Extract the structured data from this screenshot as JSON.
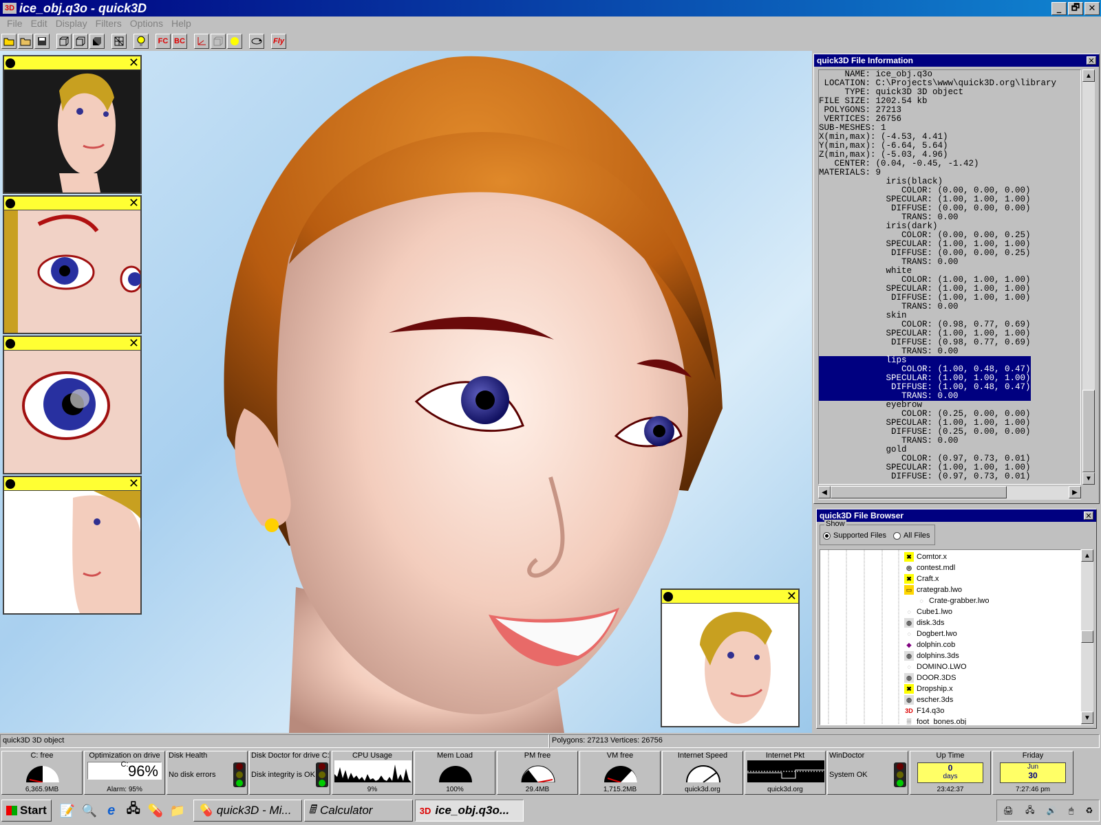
{
  "window": {
    "icon_label": "3D",
    "title": "ice_obj.q3o - quick3D",
    "buttons": [
      "_",
      "🗗",
      "✕"
    ]
  },
  "menu": [
    "File",
    "Edit",
    "Display",
    "Filters",
    "Options",
    "Help"
  ],
  "toolbar": {
    "fc_label": "FC",
    "bc_label": "BC",
    "fly_label": "Fly"
  },
  "thumbnails": {
    "close": "✕"
  },
  "info_panel": {
    "title": "quick3D File Information",
    "close": "✕",
    "lines_before": [
      "     NAME: ice_obj.q3o",
      " LOCATION: C:\\Projects\\www\\quick3D.org\\library",
      "     TYPE: quick3D 3D object",
      "FILE SIZE: 1202.54 kb",
      " POLYGONS: 27213",
      " VERTICES: 26756",
      "SUB-MESHES: 1",
      "X(min,max): (-4.53, 4.41)",
      "Y(min,max): (-6.64, 5.64)",
      "Z(min,max): (-5.03, 4.96)",
      "   CENTER: (0.04, -0.45, -1.42)",
      "MATERIALS: 9",
      "             iris(black)",
      "                COLOR: (0.00, 0.00, 0.00)",
      "             SPECULAR: (1.00, 1.00, 1.00)",
      "              DIFFUSE: (0.00, 0.00, 0.00)",
      "                TRANS: 0.00",
      "             iris(dark)",
      "                COLOR: (0.00, 0.00, 0.25)",
      "             SPECULAR: (1.00, 1.00, 1.00)",
      "              DIFFUSE: (0.00, 0.00, 0.25)",
      "                TRANS: 0.00",
      "             white",
      "                COLOR: (1.00, 1.00, 1.00)",
      "             SPECULAR: (1.00, 1.00, 1.00)",
      "              DIFFUSE: (1.00, 1.00, 1.00)",
      "                TRANS: 0.00",
      "             skin",
      "                COLOR: (0.98, 0.77, 0.69)",
      "             SPECULAR: (1.00, 1.00, 1.00)",
      "              DIFFUSE: (0.98, 0.77, 0.69)",
      "                TRANS: 0.00"
    ],
    "lines_selected": [
      "             lips",
      "                COLOR: (1.00, 0.48, 0.47)",
      "             SPECULAR: (1.00, 1.00, 1.00)",
      "              DIFFUSE: (1.00, 0.48, 0.47)",
      "                TRANS: 0.00"
    ],
    "lines_after": [
      "             eyebrow",
      "                COLOR: (0.25, 0.00, 0.00)",
      "             SPECULAR: (1.00, 1.00, 1.00)",
      "              DIFFUSE: (0.25, 0.00, 0.00)",
      "                TRANS: 0.00",
      "             gold",
      "                COLOR: (0.97, 0.73, 0.01)",
      "             SPECULAR: (1.00, 1.00, 1.00)",
      "              DIFFUSE: (0.97, 0.73, 0.01)"
    ]
  },
  "browser_panel": {
    "title": "quick3D File Browser",
    "close": "✕",
    "show_label": "Show",
    "radio_supported": "Supported Files",
    "radio_all": "All Files",
    "files": [
      {
        "name": "Comtor.x",
        "icon": "x-file-icon"
      },
      {
        "name": "contest.mdl",
        "icon": "mdl-file-icon"
      },
      {
        "name": "Craft.x",
        "icon": "x-file-icon"
      },
      {
        "name": "crategrab.lwo",
        "icon": "folder-icon"
      },
      {
        "name": "Crate-grabber.lwo",
        "icon": "lwo-file-icon"
      },
      {
        "name": "Cube1.lwo",
        "icon": "lwo-file-icon"
      },
      {
        "name": "disk.3ds",
        "icon": "3ds-file-icon"
      },
      {
        "name": "Dogbert.lwo",
        "icon": "lwo-file-icon"
      },
      {
        "name": "dolphin.cob",
        "icon": "cob-file-icon"
      },
      {
        "name": "dolphins.3ds",
        "icon": "3ds-file-icon"
      },
      {
        "name": "DOMINO.LWO",
        "icon": "lwo-file-icon"
      },
      {
        "name": "DOOR.3DS",
        "icon": "3ds-file-icon"
      },
      {
        "name": "Dropship.x",
        "icon": "x-file-icon"
      },
      {
        "name": "escher.3ds",
        "icon": "3ds-file-icon"
      },
      {
        "name": "F14.q3o",
        "icon": "q3o-file-icon"
      },
      {
        "name": "foot_bones.obj",
        "icon": "obj-file-icon"
      }
    ]
  },
  "status": {
    "left": "quick3D 3D object",
    "right": "Polygons: 27213  Vertices: 26756"
  },
  "gadgets": [
    {
      "label": "C: free",
      "value": "6,365.9MB"
    },
    {
      "label": "Optimization on drive C:",
      "big": "96%",
      "value": "Alarm: 95%"
    },
    {
      "label": "Disk Health",
      "text": "No disk errors"
    },
    {
      "label": "Disk Doctor for drive C:",
      "text": "Disk integrity is OK"
    },
    {
      "label": "CPU Usage",
      "value": "9%"
    },
    {
      "label": "Mem Load",
      "value": "100%"
    },
    {
      "label": "PM free",
      "value": "29.4MB"
    },
    {
      "label": "VM free",
      "value": "1,715.2MB"
    },
    {
      "label": "Internet Speed",
      "value": "quick3d.org"
    },
    {
      "label": "Internet Pkt",
      "value": "quick3d.org"
    },
    {
      "label": "WinDoctor",
      "text": "System OK"
    },
    {
      "label": "Up Time",
      "big": "0",
      "small": "days",
      "value": "23:42:37"
    },
    {
      "label": "Friday",
      "big": "30",
      "small": "Jun",
      "value": "7:27:46 pm"
    }
  ],
  "taskbar": {
    "start": "Start",
    "tasks": [
      "quick3D - Mi...",
      "Calculator",
      "ice_obj.q3o..."
    ],
    "active_icon": "3D"
  },
  "colors": {
    "titlebar": "#000080",
    "panel": "#c0c0c0",
    "thumb_bar": "#ffff33",
    "hair": "#b85c10",
    "skin": "#f3cdbd",
    "selection": "#000080"
  }
}
